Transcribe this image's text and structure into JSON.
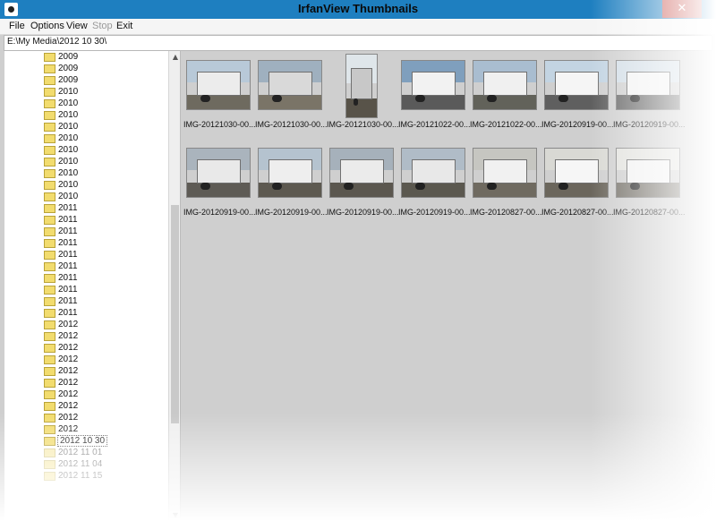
{
  "window": {
    "title": "IrfanView Thumbnails",
    "close_glyph": "✕"
  },
  "menu": {
    "file": "File",
    "options": "Options",
    "view": "View",
    "stop": "Stop",
    "exit": "Exit"
  },
  "path": "E:\\My Media\\2012 10 30\\",
  "tree": {
    "items": [
      {
        "label": "2009"
      },
      {
        "label": "2009"
      },
      {
        "label": "2009"
      },
      {
        "label": "2010"
      },
      {
        "label": "2010"
      },
      {
        "label": "2010"
      },
      {
        "label": "2010"
      },
      {
        "label": "2010"
      },
      {
        "label": "2010"
      },
      {
        "label": "2010"
      },
      {
        "label": "2010"
      },
      {
        "label": "2010"
      },
      {
        "label": "2010"
      },
      {
        "label": "2011"
      },
      {
        "label": "2011"
      },
      {
        "label": "2011"
      },
      {
        "label": "2011"
      },
      {
        "label": "2011"
      },
      {
        "label": "2011"
      },
      {
        "label": "2011"
      },
      {
        "label": "2011"
      },
      {
        "label": "2011"
      },
      {
        "label": "2011"
      },
      {
        "label": "2012"
      },
      {
        "label": "2012"
      },
      {
        "label": "2012"
      },
      {
        "label": "2012"
      },
      {
        "label": "2012"
      },
      {
        "label": "2012"
      },
      {
        "label": "2012"
      },
      {
        "label": "2012"
      },
      {
        "label": "2012"
      },
      {
        "label": "2012"
      },
      {
        "label": "2012 10 30",
        "selected": true
      },
      {
        "label": "2012 11 01",
        "faded": true
      },
      {
        "label": "2012 11 04",
        "faded": true
      },
      {
        "label": "2012 11 15",
        "faded": true
      }
    ]
  },
  "thumbnails": [
    {
      "caption": "IMG-20121030-00...",
      "sky": "#b8c9d8",
      "ground": "#6e6a5f",
      "truck": "#ececec"
    },
    {
      "caption": "IMG-20121030-00...",
      "sky": "#9fb0bf",
      "ground": "#7a7467",
      "truck": "#d9d9d9"
    },
    {
      "caption": "IMG-20121030-00...",
      "sky": "#dfe6ea",
      "ground": "#585349",
      "truck": "#c8c8c8",
      "tall": true
    },
    {
      "caption": "IMG-20121022-00...",
      "sky": "#7f9fbd",
      "ground": "#5a5a5a",
      "truck": "#f2f2f2"
    },
    {
      "caption": "IMG-20121022-00...",
      "sky": "#a9bdd0",
      "ground": "#62625a",
      "truck": "#f0f0f0"
    },
    {
      "caption": "IMG-20120919-00...",
      "sky": "#c3d4e2",
      "ground": "#5f5f5f",
      "truck": "#f5f5f5"
    },
    {
      "caption": "IMG-20120919-00...",
      "sky": "#d2dde6",
      "ground": "#6a6a6a",
      "truck": "#f3f3f3"
    },
    {
      "caption": "IMG-20120919-00...",
      "sky": "#aab4bd",
      "ground": "#5e5b55",
      "truck": "#e9e9e9"
    },
    {
      "caption": "IMG-20120919-00...",
      "sky": "#b5c3cf",
      "ground": "#5d5950",
      "truck": "#eeeeee"
    },
    {
      "caption": "IMG-20120919-00...",
      "sky": "#a6b1bb",
      "ground": "#5b574f",
      "truck": "#ebebeb"
    },
    {
      "caption": "IMG-20120919-00...",
      "sky": "#b0bcc7",
      "ground": "#5b584f",
      "truck": "#e8e8e8"
    },
    {
      "caption": "IMG-20120827-00...",
      "sky": "#c6c6c1",
      "ground": "#6f6a60",
      "truck": "#f1f1f1"
    },
    {
      "caption": "IMG-20120827-00...",
      "sky": "#d9d9d4",
      "ground": "#6b665c",
      "truck": "#f6f6f6"
    },
    {
      "caption": "IMG-20120827-00...",
      "sky": "#e2e2de",
      "ground": "#77736b",
      "truck": "#f2f2f2"
    }
  ]
}
